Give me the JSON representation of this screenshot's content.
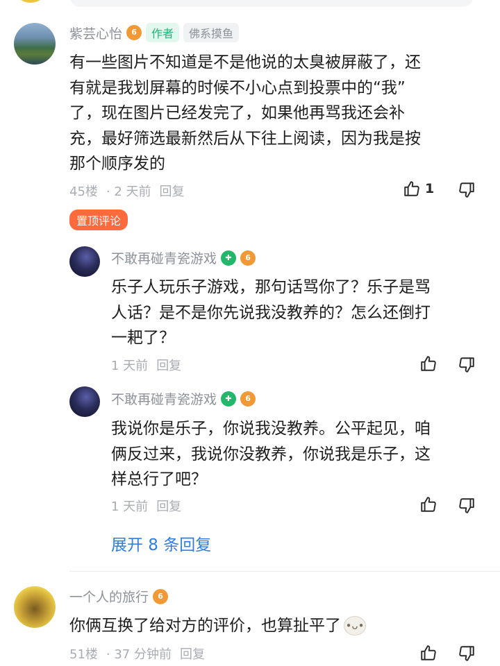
{
  "colors": {
    "accent_blue": "#2f7de1",
    "author_green": "#1fb578",
    "pin_orange": "#ff6a3d",
    "meta_grey": "#a8acb3"
  },
  "comment_main": {
    "username": "紫芸心怡",
    "level_badge": "6",
    "author_tag": "作者",
    "group_tag": "佛系摸鱼",
    "text_lines": [
      "有一些图片不知道是不是他说的太臭被屏蔽了，还",
      "有就是我划屏幕的时候不小心点到投票中的“我”",
      "了，现在图片已经发完了，如果他再骂我还会补",
      "充，最好筛选最新然后从下往上阅读，因为我是按",
      "那个顺序发的"
    ],
    "floor": "45楼",
    "time": "· 2 天前",
    "reply_label": "回复",
    "like_count": "1",
    "pin_label": "置顶评论"
  },
  "reply_1": {
    "username": "不敢再碰青瓷游戏",
    "level_badge": "6",
    "text_lines": [
      "乐子人玩乐子游戏，那句话骂你了？乐子是骂",
      "人话？是不是你先说我没教养的？怎么还倒打",
      "一耙了？"
    ],
    "time": "1 天前",
    "reply_label": "回复"
  },
  "reply_2": {
    "username": "不敢再碰青瓷游戏",
    "level_badge": "6",
    "text_lines": [
      "我说你是乐子，你说我没教养。公平起见，咱",
      "俩反过来，我说你没教养，你说我是乐子，这",
      "样总行了吧？"
    ],
    "time": "1 天前",
    "reply_label": "回复"
  },
  "expand_label": "展开 8 条回复",
  "comment_third": {
    "username": "一个人的旅行",
    "level_badge": "6",
    "text": "你俩互换了给对方的评价，也算扯平了",
    "floor": "51楼",
    "time": "· 37 分钟前",
    "reply_label": "回复"
  }
}
